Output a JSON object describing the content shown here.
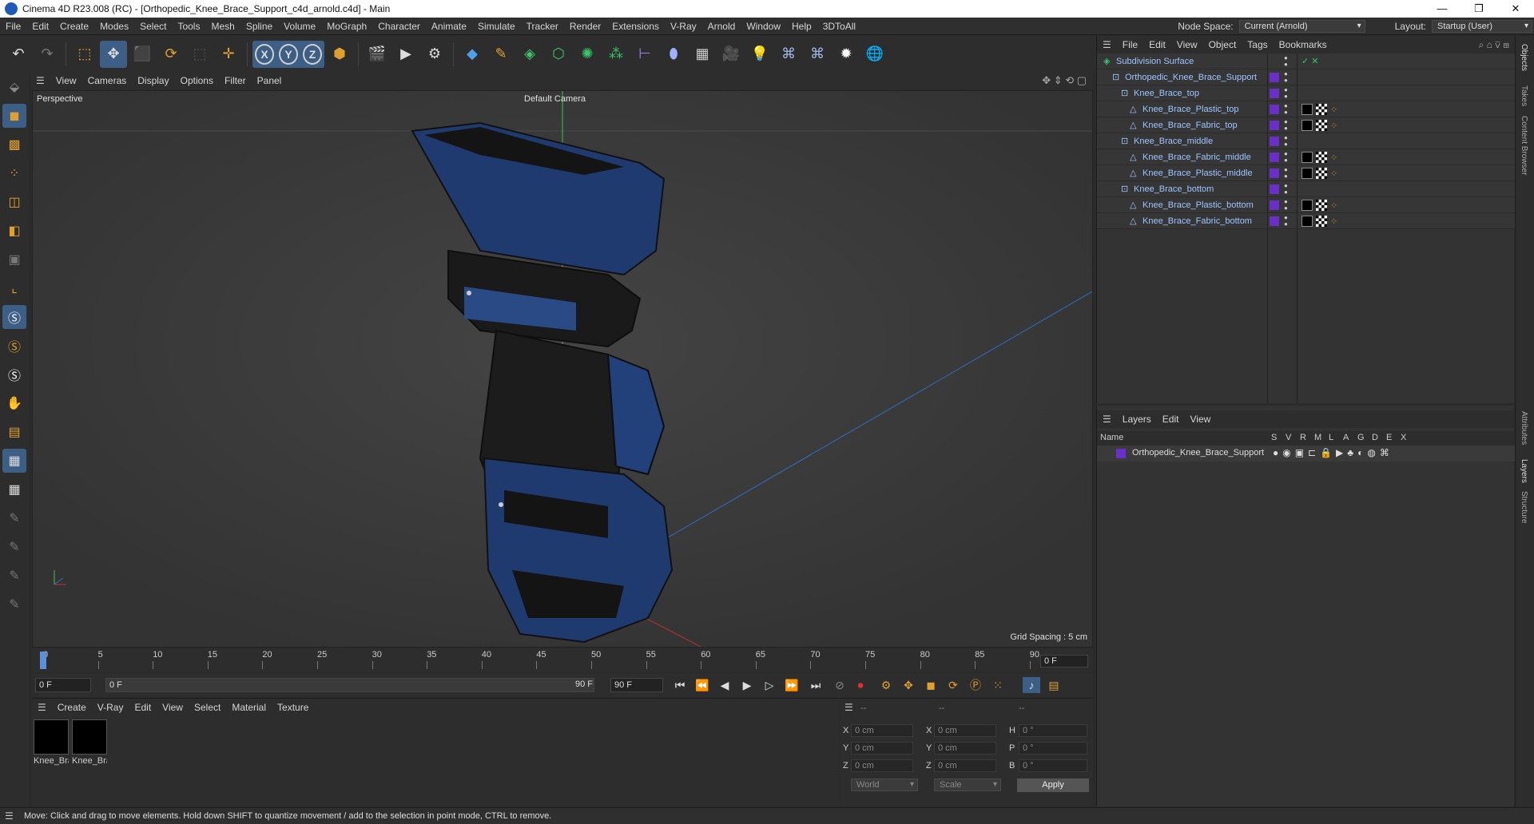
{
  "window": {
    "title": "Cinema 4D R23.008 (RC) - [Orthopedic_Knee_Brace_Support_c4d_arnold.c4d] - Main",
    "minimize": "—",
    "maximize": "❐",
    "close": "✕"
  },
  "menu": [
    "File",
    "Edit",
    "Create",
    "Modes",
    "Select",
    "Tools",
    "Mesh",
    "Spline",
    "Volume",
    "MoGraph",
    "Character",
    "Animate",
    "Simulate",
    "Tracker",
    "Render",
    "Extensions",
    "V-Ray",
    "Arnold",
    "Window",
    "Help",
    "3DToAll"
  ],
  "nodespace": {
    "label": "Node Space:",
    "value": "Current (Arnold)"
  },
  "layout": {
    "label": "Layout:",
    "value": "Startup (User)"
  },
  "toolbar": {
    "x": "X",
    "y": "Y",
    "z": "Z"
  },
  "viewport": {
    "menu": [
      "View",
      "Cameras",
      "Display",
      "Options",
      "Filter",
      "Panel"
    ],
    "label": "Perspective",
    "camera": "Default Camera",
    "grid": "Grid Spacing : 5 cm"
  },
  "timeline": {
    "ticks": [
      "0",
      "5",
      "10",
      "15",
      "20",
      "25",
      "30",
      "35",
      "40",
      "45",
      "50",
      "55",
      "60",
      "65",
      "70",
      "75",
      "80",
      "85",
      "90"
    ],
    "current": "0 F"
  },
  "transport": {
    "start": "0 F",
    "range_start": "0 F",
    "range_end": "90 F",
    "end": "90 F"
  },
  "materials": {
    "menu": [
      "Create",
      "V-Ray",
      "Edit",
      "View",
      "Select",
      "Material",
      "Texture"
    ],
    "items": [
      "Knee_Bra",
      "Knee_Bra"
    ]
  },
  "coords": {
    "header": [
      "--",
      "--",
      "--"
    ],
    "x": "X",
    "y": "Y",
    "z": "Z",
    "h": "H",
    "p": "P",
    "b": "B",
    "pos": "0 cm",
    "rot": "0 °",
    "world": "World",
    "scale": "Scale",
    "apply": "Apply"
  },
  "status": "Move: Click and drag to move elements. Hold down SHIFT to quantize movement / add to the selection in point mode, CTRL to remove.",
  "objects": {
    "menu": [
      "File",
      "Edit",
      "View",
      "Object",
      "Tags",
      "Bookmarks"
    ],
    "rows": [
      {
        "name": "Subdivision Surface",
        "indent": 0,
        "tags": false
      },
      {
        "name": "Orthopedic_Knee_Brace_Support",
        "indent": 1,
        "tags": false
      },
      {
        "name": "Knee_Brace_top",
        "indent": 2,
        "tags": false
      },
      {
        "name": "Knee_Brace_Plastic_top",
        "indent": 3,
        "tags": true
      },
      {
        "name": "Knee_Brace_Fabric_top",
        "indent": 3,
        "tags": true
      },
      {
        "name": "Knee_Brace_middle",
        "indent": 2,
        "tags": false
      },
      {
        "name": "Knee_Brace_Fabric_middle",
        "indent": 3,
        "tags": true
      },
      {
        "name": "Knee_Brace_Plastic_middle",
        "indent": 3,
        "tags": true
      },
      {
        "name": "Knee_Brace_bottom",
        "indent": 2,
        "tags": false
      },
      {
        "name": "Knee_Brace_Plastic_bottom",
        "indent": 3,
        "tags": true
      },
      {
        "name": "Knee_Brace_Fabric_bottom",
        "indent": 3,
        "tags": true
      }
    ]
  },
  "layers": {
    "menu": [
      "Layers",
      "Edit",
      "View"
    ],
    "name_col": "Name",
    "cols": [
      "S",
      "V",
      "R",
      "M",
      "L",
      "A",
      "G",
      "D",
      "E",
      "X"
    ],
    "row": "Orthopedic_Knee_Brace_Support"
  },
  "sidetabs": [
    "Objects",
    "Takes",
    "Content Browser",
    "Attributes",
    "Layers",
    "Structure"
  ]
}
